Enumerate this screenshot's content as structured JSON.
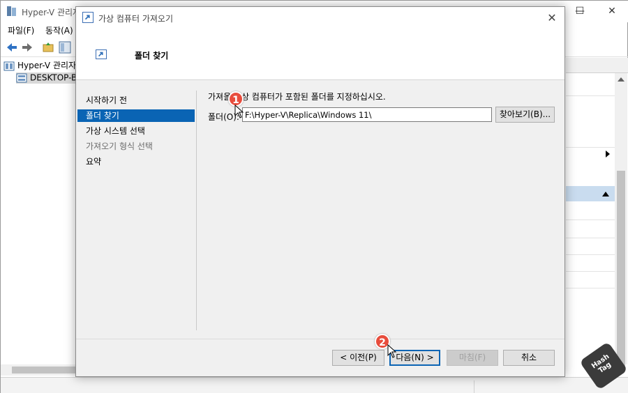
{
  "background_window": {
    "title": "Hyper-V 관리자",
    "menu": [
      "파일(F)",
      "동작(A)"
    ],
    "tree": {
      "root": "Hyper-V 관리자",
      "host": "DESKTOP-B"
    }
  },
  "dialog": {
    "title": "가상 컴퓨터 가져오기",
    "header_title": "폴더 찾기",
    "nav": [
      {
        "label": "시작하기 전",
        "state": "normal"
      },
      {
        "label": "폴더 찾기",
        "state": "active"
      },
      {
        "label": "가상 시스템 선택",
        "state": "normal"
      },
      {
        "label": "가져오기 형식 선택",
        "state": "disabled"
      },
      {
        "label": "요약",
        "state": "normal"
      }
    ],
    "description": "가져올 가상 컴퓨터가 포함된 폴더를 지정하십시오.",
    "folder_label": "폴더(O):",
    "folder_value": "F:\\Hyper-V\\Replica\\Windows 11\\",
    "browse_label": "찾아보기(B)...",
    "buttons": {
      "prev": "< 이전(P)",
      "next": "다음(N) >",
      "finish": "마침(F)",
      "cancel": "취소"
    }
  },
  "markers": [
    "1",
    "2"
  ],
  "badge": "Hash Tag",
  "colors": {
    "accent": "#0a64b4",
    "marker": "#e84d3d"
  }
}
